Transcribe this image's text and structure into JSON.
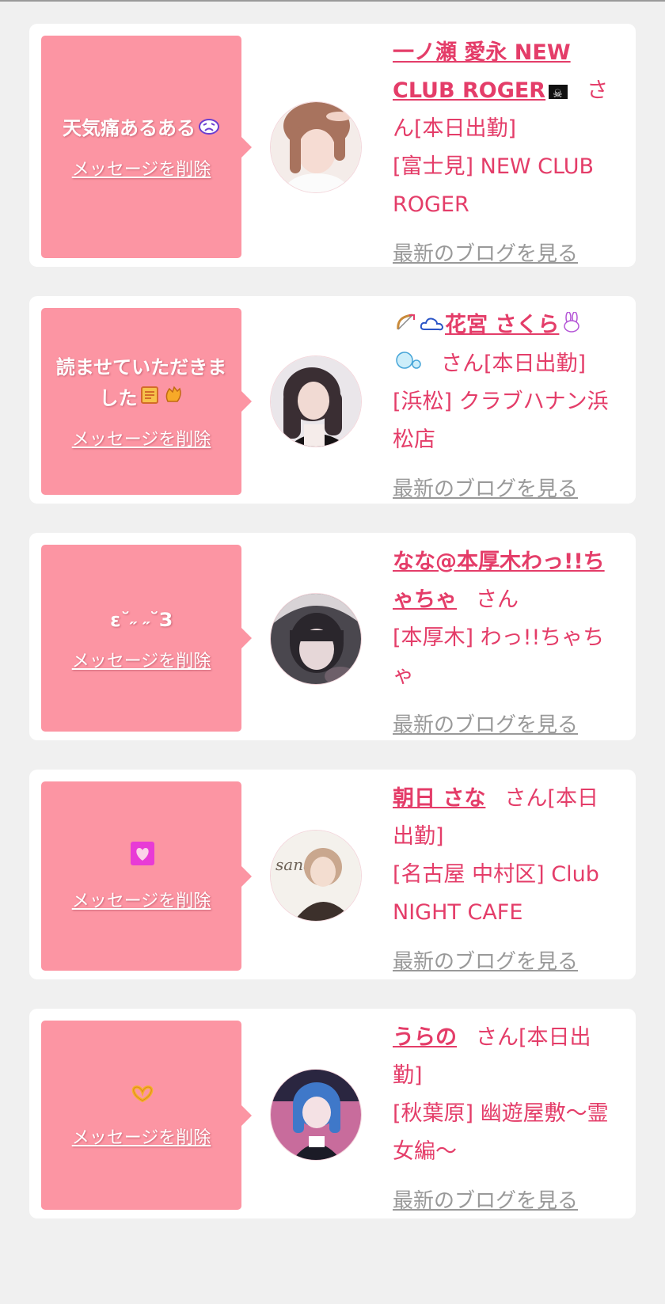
{
  "cards": [
    {
      "message": "天気痛あるある",
      "delete_label": "メッセージを削除",
      "name": "一ノ瀬 愛永 NEW CLUB ROGER",
      "suffix": "さん[本日出勤]",
      "shop": "[富士見] NEW CLUB ROGER",
      "blog_label": "最新のブログを見る",
      "avatar_colors": [
        "#e9d4cf",
        "#b28271",
        "#fbeee9"
      ]
    },
    {
      "message": "読ませていただきました",
      "delete_label": "メッセージを削除",
      "name": "花宮 さくら",
      "suffix": "さん[本日出勤]",
      "shop": "[浜松] クラブハナン浜松店",
      "blog_label": "最新のブログを見る",
      "avatar_colors": [
        "#2a2226",
        "#e7d7d4",
        "#7a6c6a"
      ]
    },
    {
      "message": "ε˘˶ ˶˘З",
      "delete_label": "メッセージを削除",
      "name": "なな@本厚木わっ!!ちゃちゃ",
      "suffix": "さん",
      "shop": "[本厚木] わっ!!ちゃちゃ",
      "blog_label": "最新のブログを見る",
      "avatar_colors": [
        "#3d3b44",
        "#c9bfc3",
        "#8a7a82"
      ]
    },
    {
      "message": "",
      "delete_label": "メッセージを削除",
      "name": "朝日 さな",
      "suffix": "さん[本日出勤]",
      "shop": "[名古屋 中村区] Club NIGHT CAFE",
      "blog_label": "最新のブログを見る",
      "avatar_colors": [
        "#f3efe9",
        "#7e6a5c",
        "#d9b49d"
      ]
    },
    {
      "message": "",
      "delete_label": "メッセージを削除",
      "name": "うらの",
      "suffix": "さん[本日出勤]",
      "shop": "[秋葉原] 幽遊屋敷～霊女編～",
      "blog_label": "最新のブログを見る",
      "avatar_colors": [
        "#3b5fb0",
        "#d36aa0",
        "#1e1e2e"
      ]
    }
  ],
  "colors": {
    "bubble": "#fc95a3",
    "accent": "#e43d69",
    "blog_link": "#999999",
    "background": "#f0f0f0"
  }
}
